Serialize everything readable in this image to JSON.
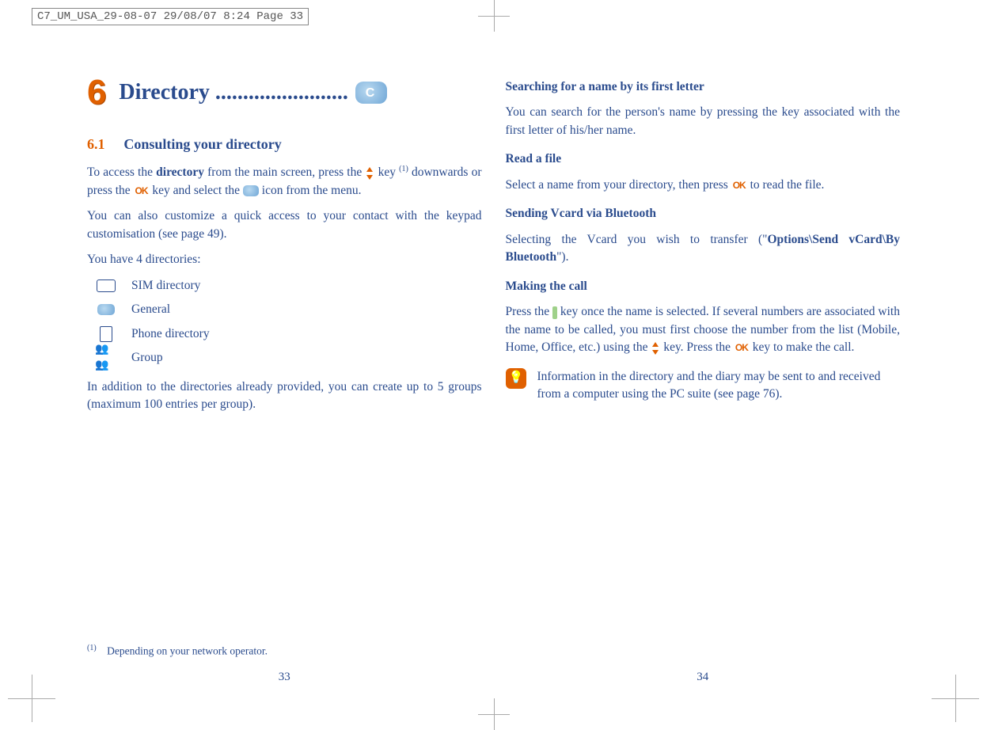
{
  "slug": "C7_UM_USA_29-08-07  29/08/07  8:24  Page 33",
  "left": {
    "chapter_num": "6",
    "chapter_title": "Directory ........................",
    "section_num": "6.1",
    "section_title": "Consulting your directory",
    "p1a": "To access the ",
    "p1_bold": "directory",
    "p1b": " from the main screen, press the ",
    "p1c": " key ",
    "p1_sup": "(1)",
    "p1d": " downwards or press the ",
    "p1e": " key and select the ",
    "p1f": " icon from the menu.",
    "p2": "You can also customize a quick access to your contact with the keypad customisation (see page 49).",
    "p3": "You have 4 directories:",
    "dirs": [
      {
        "label": "SIM directory"
      },
      {
        "label": "General"
      },
      {
        "label": "Phone directory"
      },
      {
        "label": "Group"
      }
    ],
    "p4": "In addition to the directories already provided, you can create up to 5 groups (maximum 100 entries per group).",
    "foot_sup": "(1)",
    "foot_text": "Depending on your network operator.",
    "page_num": "33"
  },
  "right": {
    "h1": "Searching for a name by its first letter",
    "p1": "You can search for the person's name by pressing the key associated with the first letter of his/her name.",
    "h2": "Read a file",
    "p2a": "Select a name from your directory, then press ",
    "p2b": " to read the file.",
    "h3": "Sending Vcard via Bluetooth",
    "p3a": "Selecting the Vcard you wish to transfer (\"",
    "p3_bold": "Options\\Send vCard\\By Bluetooth",
    "p3b": "\").",
    "h4": "Making the call",
    "p4a": "Press the ",
    "p4b": " key once the name is selected. If several numbers are associated with the name to be called, you must first choose the number from the list (Mobile, Home, Office, etc.) using the ",
    "p4c": " key. Press the ",
    "p4d": " key to make the call.",
    "info": "Information in the directory and the diary may be sent to and received from a computer using the PC suite (see page 76).",
    "page_num": "34"
  }
}
